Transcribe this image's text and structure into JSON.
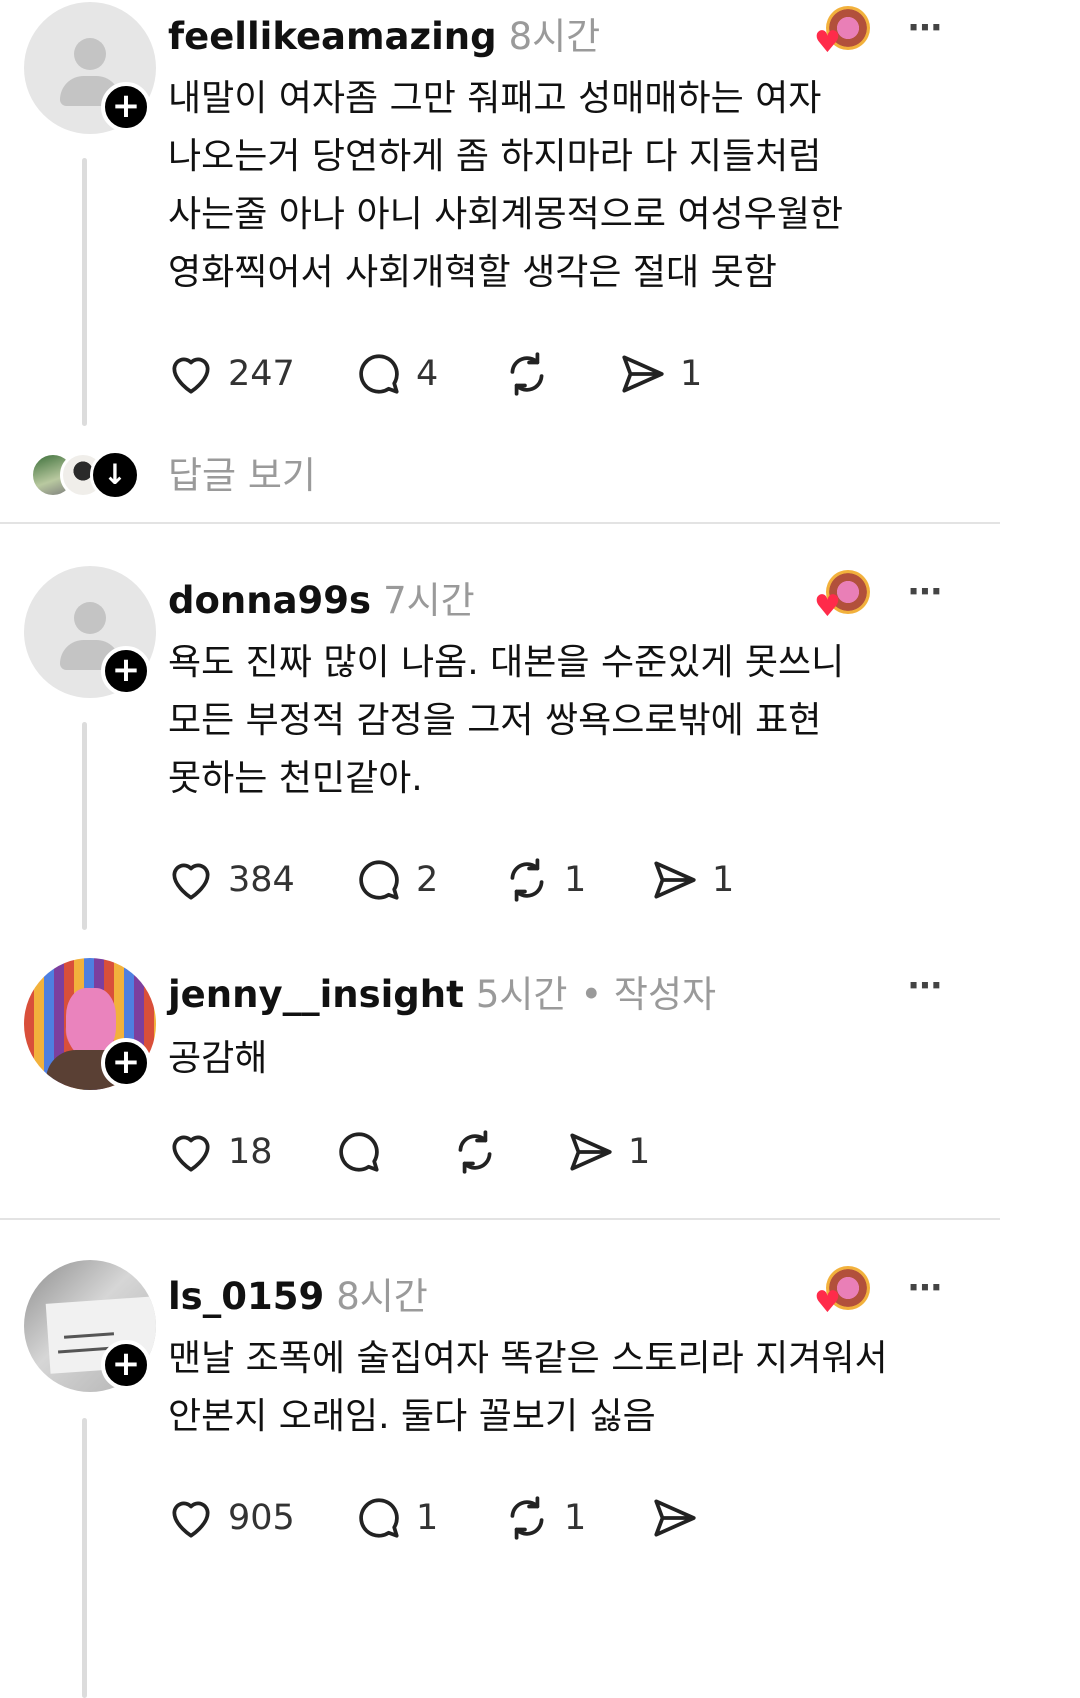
{
  "posts": [
    {
      "username": "feellikeamazing",
      "time": "8시간",
      "lines": [
        "내말이 여자좀 그만 줘패고 성매매하는 여자",
        "나오는거 당연하게 좀 하지마라 다 지들처럼",
        "사는줄 아나 아니 사회계몽적으로 여성우월한",
        "영화찍어서 사회개혁할 생각은 절대 못함"
      ],
      "likes": "247",
      "comments": "4",
      "reposts": "",
      "shares": "1",
      "view_replies": "답글 보기"
    },
    {
      "username": "donna99s",
      "time": "7시간",
      "lines": [
        "욕도 진짜 많이 나옴. 대본을 수준있게 못쓰니",
        "모든 부정적 감정을 그저 쌍욕으로밖에 표현",
        "못하는 천민같아."
      ],
      "likes": "384",
      "comments": "2",
      "reposts": "1",
      "shares": "1"
    },
    {
      "username": "jenny__insight",
      "time": "5시간",
      "author_tag": "• 작성자",
      "lines": [
        "공감해"
      ],
      "likes": "18",
      "comments": "",
      "reposts": "",
      "shares": "1"
    },
    {
      "username": "ls_0159",
      "time": "8시간",
      "lines": [
        "맨날 조폭에 술집여자 똑같은 스토리라 지겨워서",
        "안본지 오래임. 둘다 꼴보기 싫음"
      ],
      "likes": "905",
      "comments": "1",
      "reposts": "1",
      "shares": ""
    }
  ],
  "icons": {
    "more": "⋯",
    "plus": "+",
    "heart_badge": "♥",
    "down_arrow": "↓"
  },
  "colors": {
    "like_badge": "#ff2b4a",
    "muted": "#9a9a9a"
  }
}
